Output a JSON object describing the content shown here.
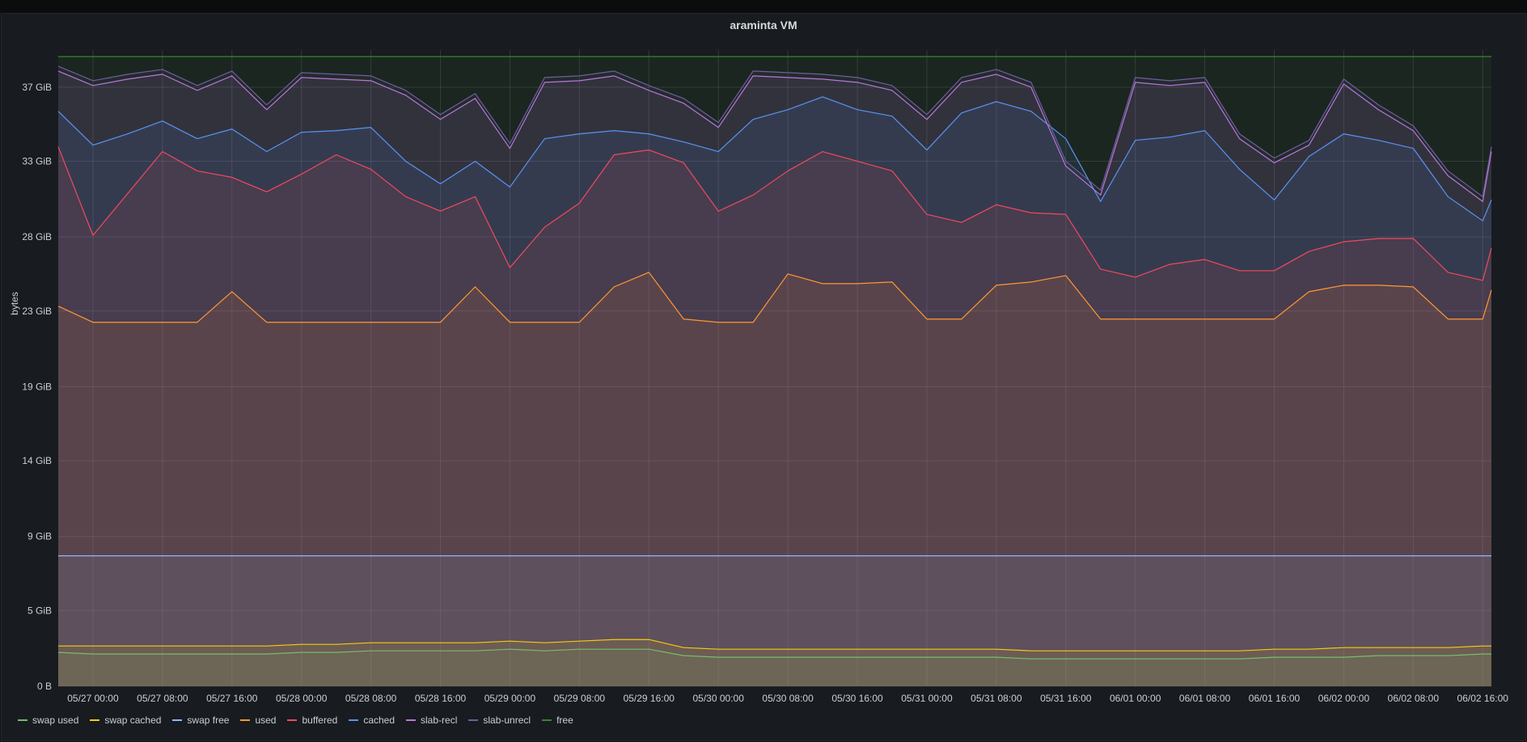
{
  "panel": {
    "title": "araminta VM"
  },
  "colors": {
    "swap used": "#73bf69",
    "swap cached": "#f2cc0c",
    "swap free": "#8ab8ff",
    "used": "#ff9830",
    "buffered": "#f2495c",
    "cached": "#5794f2",
    "slab-recl": "#b877d9",
    "slab-unrecl": "#705da0",
    "free": "#37872d"
  },
  "chart_data": {
    "type": "area",
    "title": "araminta VM",
    "ylabel": "bytes",
    "ylim": [
      0,
      39.5
    ],
    "y_unit": "GiB",
    "yticks": [
      {
        "v": 0,
        "label": "0 B"
      },
      {
        "v": 4.7,
        "label": "5 GiB"
      },
      {
        "v": 9.3,
        "label": "9 GiB"
      },
      {
        "v": 14,
        "label": "14 GiB"
      },
      {
        "v": 18.6,
        "label": "19 GiB"
      },
      {
        "v": 23.3,
        "label": "23 GiB"
      },
      {
        "v": 27.9,
        "label": "28 GiB"
      },
      {
        "v": 32.6,
        "label": "33 GiB"
      },
      {
        "v": 37.2,
        "label": "37 GiB"
      }
    ],
    "xrange": [
      "05/26 20:00",
      "06/02 17:00"
    ],
    "xticks": [
      "05/27 00:00",
      "05/27 08:00",
      "05/27 16:00",
      "05/28 00:00",
      "05/28 08:00",
      "05/28 16:00",
      "05/29 00:00",
      "05/29 08:00",
      "05/29 16:00",
      "05/30 00:00",
      "05/30 08:00",
      "05/30 16:00",
      "05/31 00:00",
      "05/31 08:00",
      "05/31 16:00",
      "06/01 00:00",
      "06/01 08:00",
      "06/01 16:00",
      "06/02 00:00",
      "06/02 08:00",
      "06/02 16:00"
    ],
    "legend_position": "bottom-left",
    "grid": true,
    "x": [
      "05/26 20:00",
      "05/27 00:00",
      "05/27 04:00",
      "05/27 08:00",
      "05/27 12:00",
      "05/27 16:00",
      "05/27 20:00",
      "05/28 00:00",
      "05/28 04:00",
      "05/28 08:00",
      "05/28 12:00",
      "05/28 16:00",
      "05/28 20:00",
      "05/29 00:00",
      "05/29 04:00",
      "05/29 08:00",
      "05/29 12:00",
      "05/29 16:00",
      "05/29 20:00",
      "05/30 00:00",
      "05/30 04:00",
      "05/30 08:00",
      "05/30 12:00",
      "05/30 16:00",
      "05/30 20:00",
      "05/31 00:00",
      "05/31 04:00",
      "05/31 08:00",
      "05/31 12:00",
      "05/31 16:00",
      "05/31 20:00",
      "06/01 00:00",
      "06/01 04:00",
      "06/01 08:00",
      "06/01 12:00",
      "06/01 16:00",
      "06/01 20:00",
      "06/02 00:00",
      "06/02 04:00",
      "06/02 08:00",
      "06/02 12:00",
      "06/02 16:00",
      "06/02 17:00"
    ],
    "series": [
      {
        "name": "swap used",
        "values": [
          2.1,
          2.0,
          2.0,
          2.0,
          2.0,
          2.0,
          2.0,
          2.1,
          2.1,
          2.2,
          2.2,
          2.2,
          2.2,
          2.3,
          2.2,
          2.3,
          2.3,
          2.3,
          1.9,
          1.8,
          1.8,
          1.8,
          1.8,
          1.8,
          1.8,
          1.8,
          1.8,
          1.8,
          1.7,
          1.7,
          1.7,
          1.7,
          1.7,
          1.7,
          1.7,
          1.8,
          1.8,
          1.8,
          1.9,
          1.9,
          1.9,
          2.0,
          2.0
        ]
      },
      {
        "name": "swap cached",
        "values": [
          2.5,
          2.5,
          2.5,
          2.5,
          2.5,
          2.5,
          2.5,
          2.6,
          2.6,
          2.7,
          2.7,
          2.7,
          2.7,
          2.8,
          2.7,
          2.8,
          2.9,
          2.9,
          2.4,
          2.3,
          2.3,
          2.3,
          2.3,
          2.3,
          2.3,
          2.3,
          2.3,
          2.3,
          2.2,
          2.2,
          2.2,
          2.2,
          2.2,
          2.2,
          2.2,
          2.3,
          2.3,
          2.4,
          2.4,
          2.4,
          2.4,
          2.5,
          2.5
        ]
      },
      {
        "name": "swap free",
        "values": [
          8.1,
          8.1,
          8.1,
          8.1,
          8.1,
          8.1,
          8.1,
          8.1,
          8.1,
          8.1,
          8.1,
          8.1,
          8.1,
          8.1,
          8.1,
          8.1,
          8.1,
          8.1,
          8.1,
          8.1,
          8.1,
          8.1,
          8.1,
          8.1,
          8.1,
          8.1,
          8.1,
          8.1,
          8.1,
          8.1,
          8.1,
          8.1,
          8.1,
          8.1,
          8.1,
          8.1,
          8.1,
          8.1,
          8.1,
          8.1,
          8.1,
          8.1,
          8.1
        ]
      },
      {
        "name": "used",
        "values": [
          23.6,
          22.6,
          22.6,
          22.6,
          22.6,
          24.5,
          22.6,
          22.6,
          22.6,
          22.6,
          22.6,
          22.6,
          24.8,
          22.6,
          22.6,
          22.6,
          24.8,
          25.7,
          22.8,
          22.6,
          22.6,
          25.6,
          25.0,
          25.0,
          25.1,
          22.8,
          22.8,
          24.9,
          25.1,
          25.5,
          22.8,
          22.8,
          22.8,
          22.8,
          22.8,
          22.8,
          24.5,
          24.9,
          24.9,
          24.8,
          22.8,
          22.8,
          24.6
        ]
      },
      {
        "name": "buffered",
        "values": [
          33.5,
          28.0,
          30.6,
          33.2,
          32.0,
          31.6,
          30.7,
          31.8,
          33.0,
          32.1,
          30.4,
          29.5,
          30.4,
          26.0,
          28.5,
          30.0,
          33.0,
          33.3,
          32.5,
          29.5,
          30.5,
          32.0,
          33.2,
          32.6,
          32.0,
          29.3,
          28.8,
          29.9,
          29.4,
          29.3,
          25.9,
          25.4,
          26.2,
          26.5,
          25.8,
          25.8,
          27.0,
          27.6,
          27.8,
          27.8,
          25.7,
          25.2,
          27.2
        ]
      },
      {
        "name": "cached",
        "values": [
          35.7,
          33.6,
          34.3,
          35.1,
          34.0,
          34.6,
          33.2,
          34.4,
          34.5,
          34.7,
          32.6,
          31.2,
          32.6,
          31.0,
          34.0,
          34.3,
          34.5,
          34.3,
          33.8,
          33.2,
          35.2,
          35.8,
          36.6,
          35.8,
          35.4,
          33.3,
          35.6,
          36.3,
          35.7,
          34.0,
          30.1,
          33.9,
          34.1,
          34.5,
          32.1,
          30.2,
          32.9,
          34.3,
          33.9,
          33.4,
          30.4,
          28.9,
          30.2
        ]
      },
      {
        "name": "slab-recl",
        "values": [
          38.2,
          37.3,
          37.7,
          38.0,
          37.0,
          37.9,
          35.8,
          37.8,
          37.7,
          37.6,
          36.7,
          35.2,
          36.5,
          33.4,
          37.5,
          37.6,
          37.9,
          37.0,
          36.2,
          34.7,
          37.9,
          37.8,
          37.7,
          37.5,
          37.0,
          35.2,
          37.5,
          38.0,
          37.2,
          32.3,
          30.5,
          37.5,
          37.3,
          37.5,
          34.0,
          32.5,
          33.6,
          37.4,
          35.8,
          34.5,
          31.7,
          30.1,
          33.2
        ]
      },
      {
        "name": "slab-unrecl",
        "values": [
          38.5,
          37.6,
          38.0,
          38.3,
          37.3,
          38.2,
          36.1,
          38.1,
          38.0,
          37.9,
          37.0,
          35.5,
          36.8,
          33.7,
          37.8,
          37.9,
          38.2,
          37.3,
          36.5,
          35.0,
          38.2,
          38.1,
          38.0,
          37.8,
          37.3,
          35.5,
          37.8,
          38.3,
          37.5,
          32.6,
          30.8,
          37.8,
          37.6,
          37.8,
          34.3,
          32.8,
          33.9,
          37.7,
          36.1,
          34.8,
          32.0,
          30.4,
          33.5
        ]
      },
      {
        "name": "free",
        "values": [
          39.1,
          39.1,
          39.1,
          39.1,
          39.1,
          39.1,
          39.1,
          39.1,
          39.1,
          39.1,
          39.1,
          39.1,
          39.1,
          39.1,
          39.1,
          39.1,
          39.1,
          39.1,
          39.1,
          39.1,
          39.1,
          39.1,
          39.1,
          39.1,
          39.1,
          39.1,
          39.1,
          39.1,
          39.1,
          39.1,
          39.1,
          39.1,
          39.1,
          39.1,
          39.1,
          39.1,
          39.1,
          39.1,
          39.1,
          39.1,
          39.1,
          39.1,
          39.1
        ]
      }
    ]
  }
}
